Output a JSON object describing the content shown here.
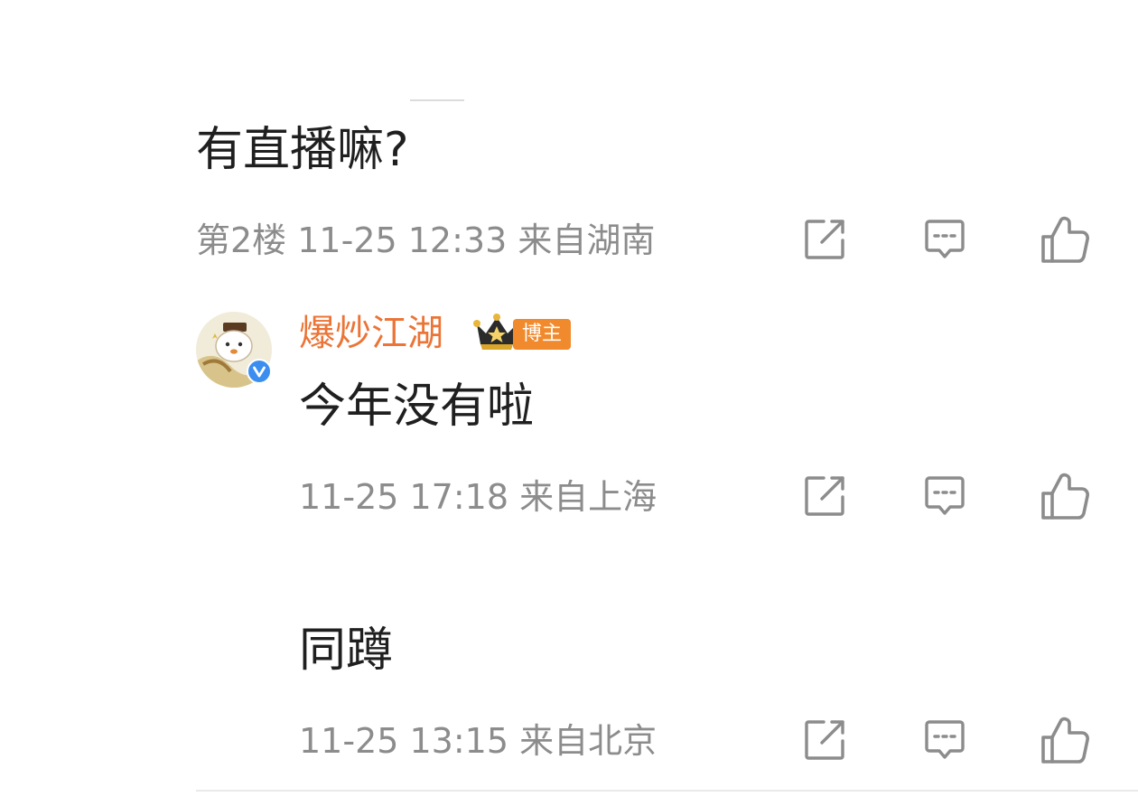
{
  "comment": {
    "text": "有直播嘛?",
    "meta": "第2楼 11-25 12:33 来自湖南"
  },
  "reply_1": {
    "username": "爆炒江湖",
    "tag": "博主",
    "text": "今年没有啦",
    "meta": "11-25 17:18 来自上海"
  },
  "reply_2": {
    "text": "同蹲",
    "meta": "11-25 13:15 来自北京"
  },
  "colors": {
    "username": "#eb7436",
    "tag_bg": "#f08a2c",
    "meta": "#8c8c8c",
    "icon": "#8c8c8c",
    "verified": "#3b8ef0"
  }
}
